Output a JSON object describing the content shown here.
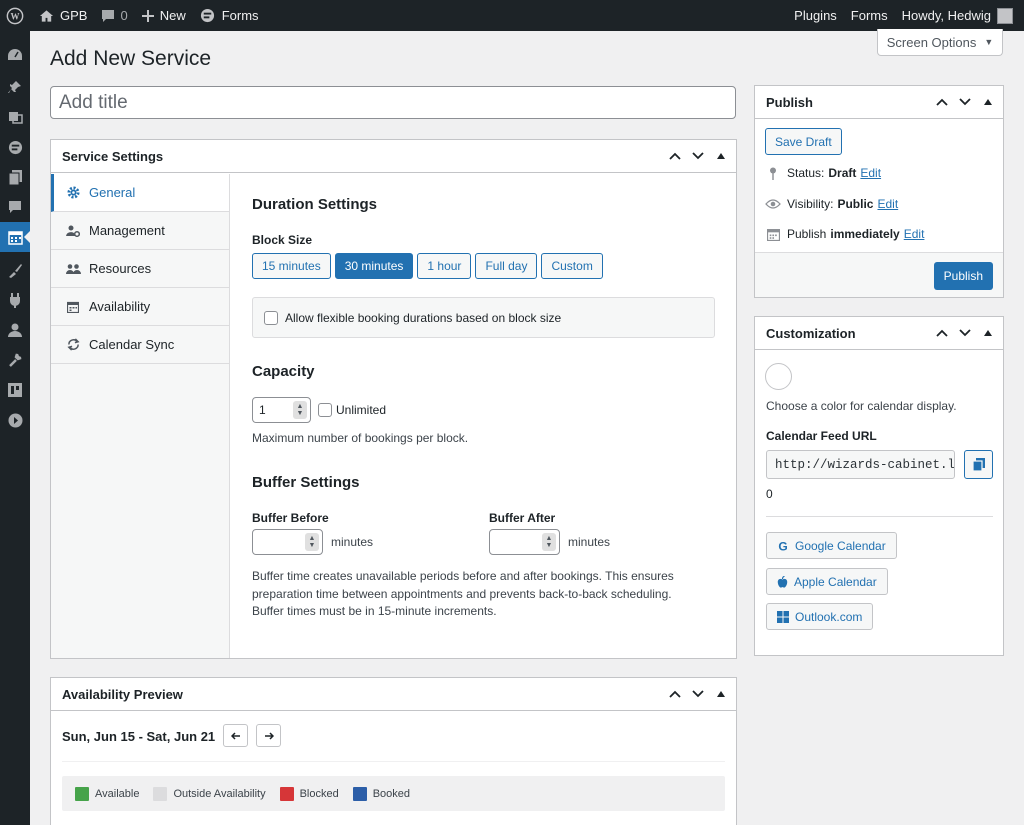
{
  "adminbar": {
    "site_name": "GPB",
    "comments_count": "0",
    "new_label": "New",
    "forms_label": "Forms",
    "right": {
      "plugins": "Plugins",
      "forms": "Forms",
      "howdy": "Howdy, Hedwig"
    }
  },
  "screen_options": "Screen Options",
  "page_title": "Add New Service",
  "title_placeholder": "Add title",
  "service_settings": {
    "title": "Service Settings",
    "nav": [
      {
        "label": "General",
        "icon": "gear-icon",
        "active": true
      },
      {
        "label": "Management",
        "icon": "user-gear-icon"
      },
      {
        "label": "Resources",
        "icon": "group-icon"
      },
      {
        "label": "Availability",
        "icon": "calendar-icon"
      },
      {
        "label": "Calendar Sync",
        "icon": "sync-icon"
      }
    ],
    "duration_heading": "Duration Settings",
    "block_size_label": "Block Size",
    "block_sizes": [
      "15 minutes",
      "30 minutes",
      "1 hour",
      "Full day",
      "Custom"
    ],
    "block_size_selected": "30 minutes",
    "flexible_label": "Allow flexible booking durations based on block size",
    "capacity_heading": "Capacity",
    "capacity_value": "1",
    "unlimited_label": "Unlimited",
    "capacity_help": "Maximum number of bookings per block.",
    "buffer_heading": "Buffer Settings",
    "buffer_before_label": "Buffer Before",
    "buffer_after_label": "Buffer After",
    "minutes_unit": "minutes",
    "buffer_help_1": "Buffer time creates unavailable periods before and after bookings. This ensures",
    "buffer_help_2": "preparation time between appointments and prevents back-to-back scheduling.",
    "buffer_help_3": "Buffer times must be in 15-minute increments."
  },
  "availability_preview": {
    "title": "Availability Preview",
    "date_range": "Sun, Jun 15 - Sat, Jun 21",
    "legend": [
      {
        "label": "Available",
        "color": "#46a34a"
      },
      {
        "label": "Outside Availability",
        "color": "#dcdcde"
      },
      {
        "label": "Blocked",
        "color": "#d63638"
      },
      {
        "label": "Booked",
        "color": "#2c5ea8"
      }
    ]
  },
  "publish": {
    "title": "Publish",
    "save_draft": "Save Draft",
    "status_label": "Status:",
    "status_value": "Draft",
    "visibility_label": "Visibility:",
    "visibility_value": "Public",
    "publish_label": "Publish",
    "publish_value": "immediately",
    "edit": "Edit",
    "publish_button": "Publish"
  },
  "customization": {
    "title": "Customization",
    "color_help": "Choose a color for calendar display.",
    "feed_label": "Calendar Feed URL",
    "feed_url": "http://wizards-cabinet.lo",
    "feed_count": "0",
    "google": "Google Calendar",
    "apple": "Apple Calendar",
    "outlook": "Outlook.com"
  }
}
